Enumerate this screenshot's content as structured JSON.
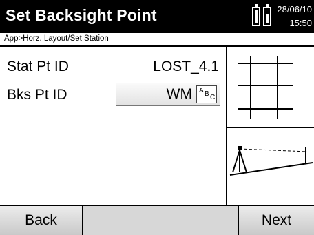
{
  "header": {
    "title": "Set Backsight Point",
    "date": "28/06/10",
    "time": "15:50",
    "battery_icons": [
      "battery-icon",
      "battery-icon"
    ]
  },
  "breadcrumb": "App>Horz. Layout/Set Station",
  "fields": {
    "stat_pt_label": "Stat Pt ID",
    "stat_pt_value": "LOST_4.1",
    "bks_pt_label": "Bks Pt ID",
    "bks_pt_value": "WM",
    "abc_icon": "abc-keyboard-icon",
    "abc_a": "A",
    "abc_b": "B",
    "abc_c": "C"
  },
  "side_panel": {
    "top_icon": "grid-icon",
    "bottom_icon": "tripod-backsight-icon"
  },
  "footer": {
    "back_label": "Back",
    "next_label": "Next"
  }
}
